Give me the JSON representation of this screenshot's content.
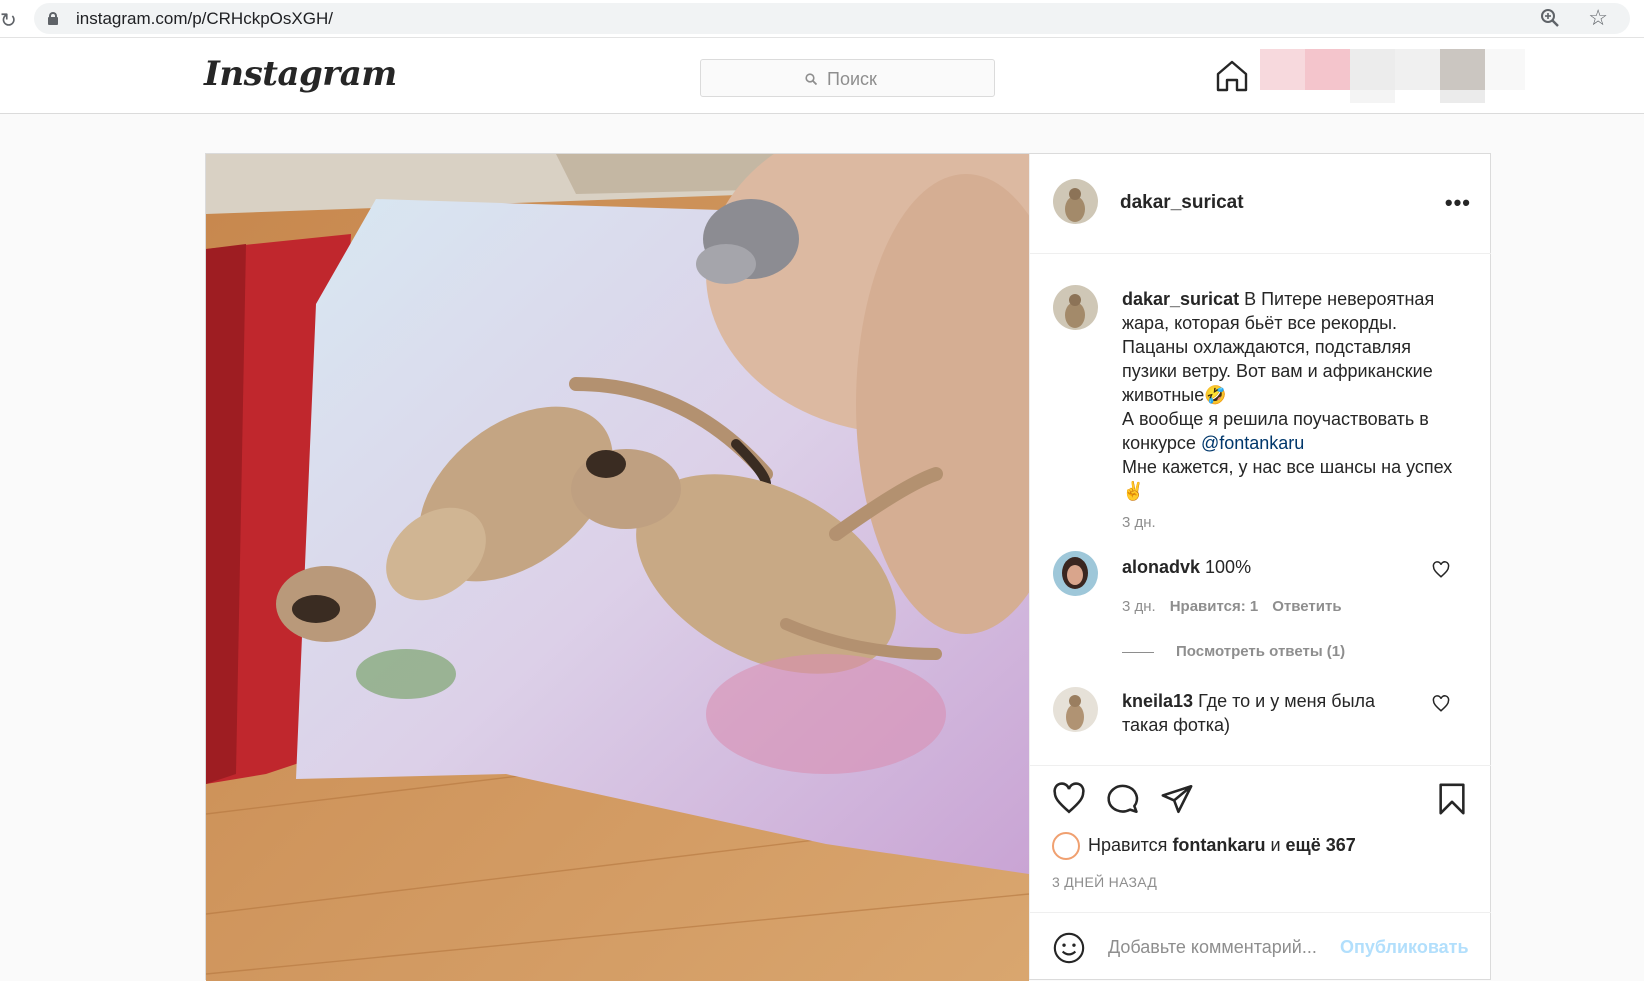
{
  "browser": {
    "url": "instagram.com/p/CRHckpOsXGH/"
  },
  "header": {
    "logo": "Instagram",
    "search_placeholder": "Поиск"
  },
  "post": {
    "author": "dakar_suricat",
    "caption": {
      "user": "dakar_suricat",
      "line1": " В Питере невероятная жара, которая бьёт все рекорды. Пацаны охлаждаются, подставляя пузики ветру. Вот вам и африканские животные",
      "emoji1": "🤣",
      "line2": "А вообще я решила поучаствовать в конкурсе ",
      "mention": "@fontankaru",
      "line3": "Мне кажется, у нас все шансы на успех",
      "emoji2": "✌",
      "time": "3 дн."
    },
    "comments": [
      {
        "user": "alonadvk",
        "text": " 100%",
        "time": "3 дн.",
        "likes": "Нравится: 1",
        "reply": "Ответить",
        "view_replies": "Посмотреть ответы (1)"
      },
      {
        "user": "kneila13",
        "text": " Где то и у меня была такая фотка)"
      }
    ],
    "likes": {
      "prefix": "Нравится ",
      "user": "fontankaru",
      "middle": " и ",
      "rest": "ещё 367"
    },
    "date": "3 ДНЕЙ НАЗАД",
    "comment_placeholder": "Добавьте комментарий...",
    "publish": "Опубликовать"
  }
}
